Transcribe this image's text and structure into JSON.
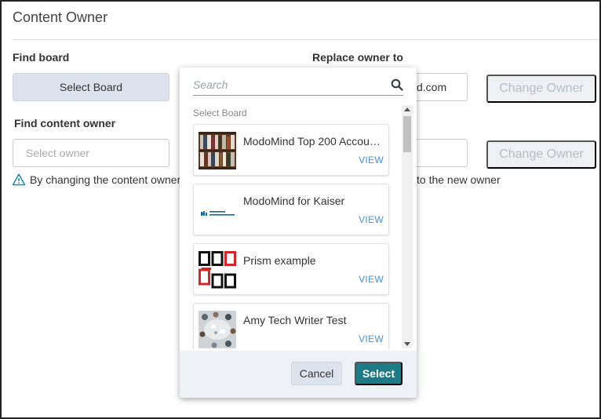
{
  "page": {
    "title": "Content Owner"
  },
  "find_board": {
    "label": "Find board",
    "button_label": "Select Board"
  },
  "replace_owner": {
    "label": "Replace owner to",
    "value": "d.com",
    "button_label": "Change Owner"
  },
  "find_content_owner": {
    "label": "Find content owner",
    "placeholder": "Select owner",
    "button_label": "Change Owner"
  },
  "warning": {
    "left_text": "By changing the content owner,",
    "right_text": "to the new owner"
  },
  "popup": {
    "search_placeholder": "Search",
    "section_label": "Select Board",
    "boards": [
      {
        "title": "ModoMind Top 200 Accou…",
        "view": "VIEW",
        "thumb": "bookshelf-image"
      },
      {
        "title": "ModoMind for Kaiser",
        "view": "VIEW",
        "thumb": "kaiser-logo"
      },
      {
        "title": "Prism example",
        "view": "VIEW",
        "thumb": "prism-squares-image"
      },
      {
        "title": "Amy Tech Writer Test",
        "view": "VIEW",
        "thumb": "meeting-table-image"
      }
    ],
    "cancel_label": "Cancel",
    "select_label": "Select"
  },
  "colors": {
    "accent": "#1d7b86",
    "link": "#4a90d9",
    "secondary_button": "#dde3ec",
    "footer": "#eef2f7"
  }
}
